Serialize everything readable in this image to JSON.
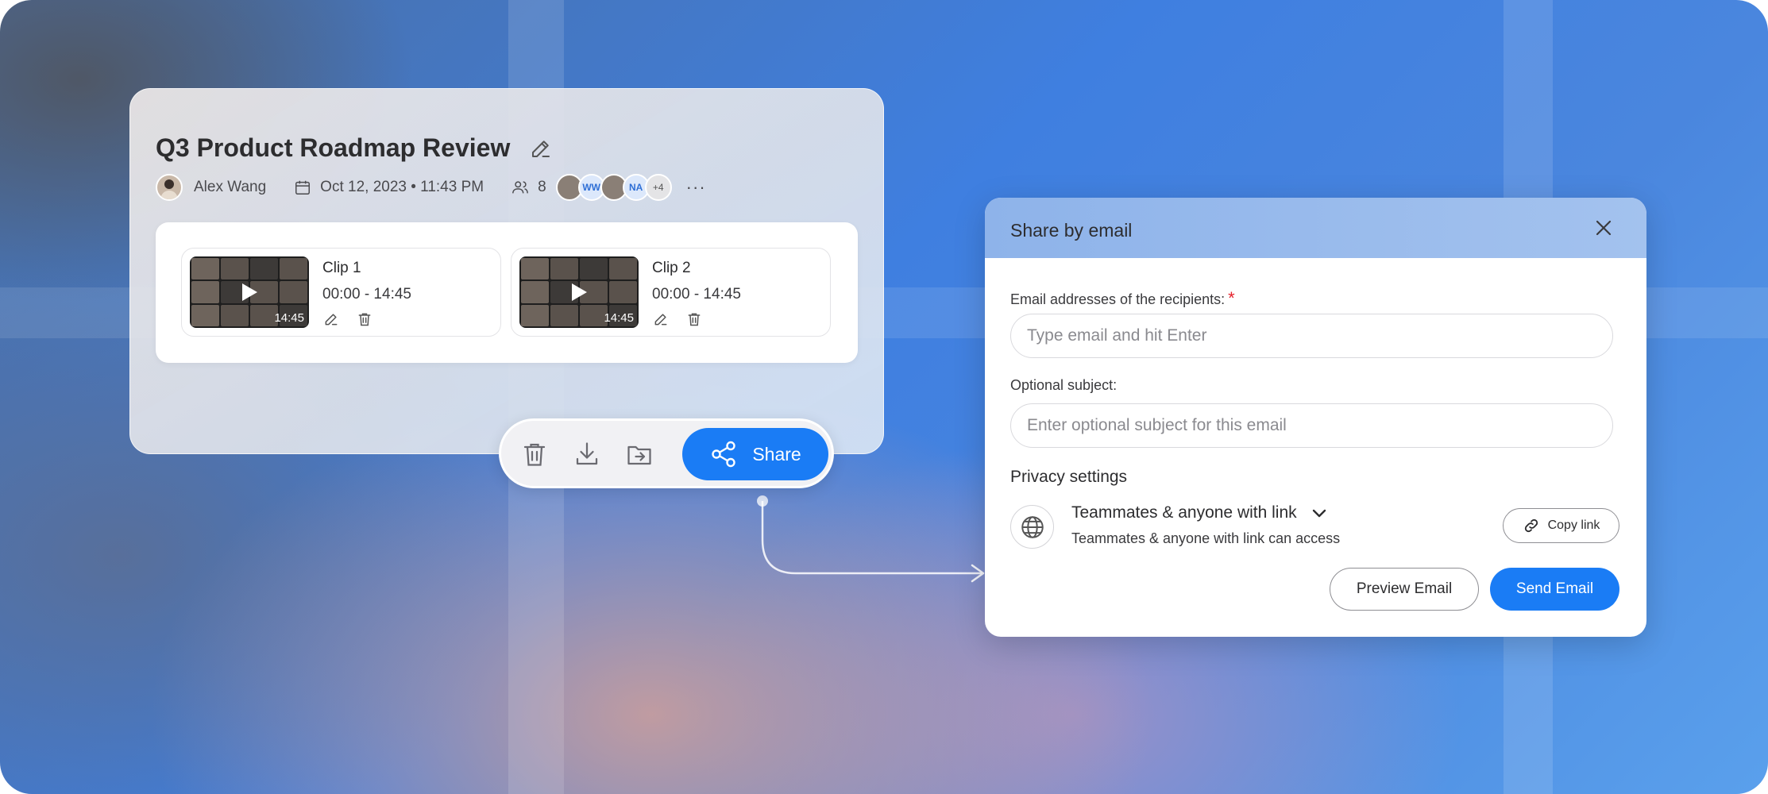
{
  "recording": {
    "title": "Q3 Product Roadmap Review",
    "owner": "Alex Wang",
    "datetime": "Oct 12, 2023 • 11:43 PM",
    "participant_count": "8",
    "avatars": [
      "",
      "WW",
      "",
      "NA"
    ],
    "avatars_more": "+4",
    "more_label": "···"
  },
  "clips": [
    {
      "name": "Clip 1",
      "range": "00:00 - 14:45",
      "duration": "14:45"
    },
    {
      "name": "Clip 2",
      "range": "00:00 - 14:45",
      "duration": "14:45"
    }
  ],
  "toolbar": {
    "share_label": "Share",
    "icons": [
      "trash-icon",
      "download-icon",
      "move-to-folder-icon",
      "share-icon"
    ]
  },
  "dialog": {
    "title": "Share by email",
    "recipients_label": "Email addresses of the recipients:",
    "required_mark": "*",
    "recipients_placeholder": "Type email and hit Enter",
    "subject_label": "Optional subject:",
    "subject_placeholder": "Enter optional subject for this email",
    "privacy_title": "Privacy settings",
    "access_value": "Teammates & anyone with link",
    "access_description": "Teammates & anyone with link can access",
    "copy_link_label": "Copy link",
    "preview_label": "Preview Email",
    "send_label": "Send Email"
  },
  "colors": {
    "accent": "#1a7cf5",
    "required": "#e5222c",
    "dialog_header": "#9bbcec"
  }
}
